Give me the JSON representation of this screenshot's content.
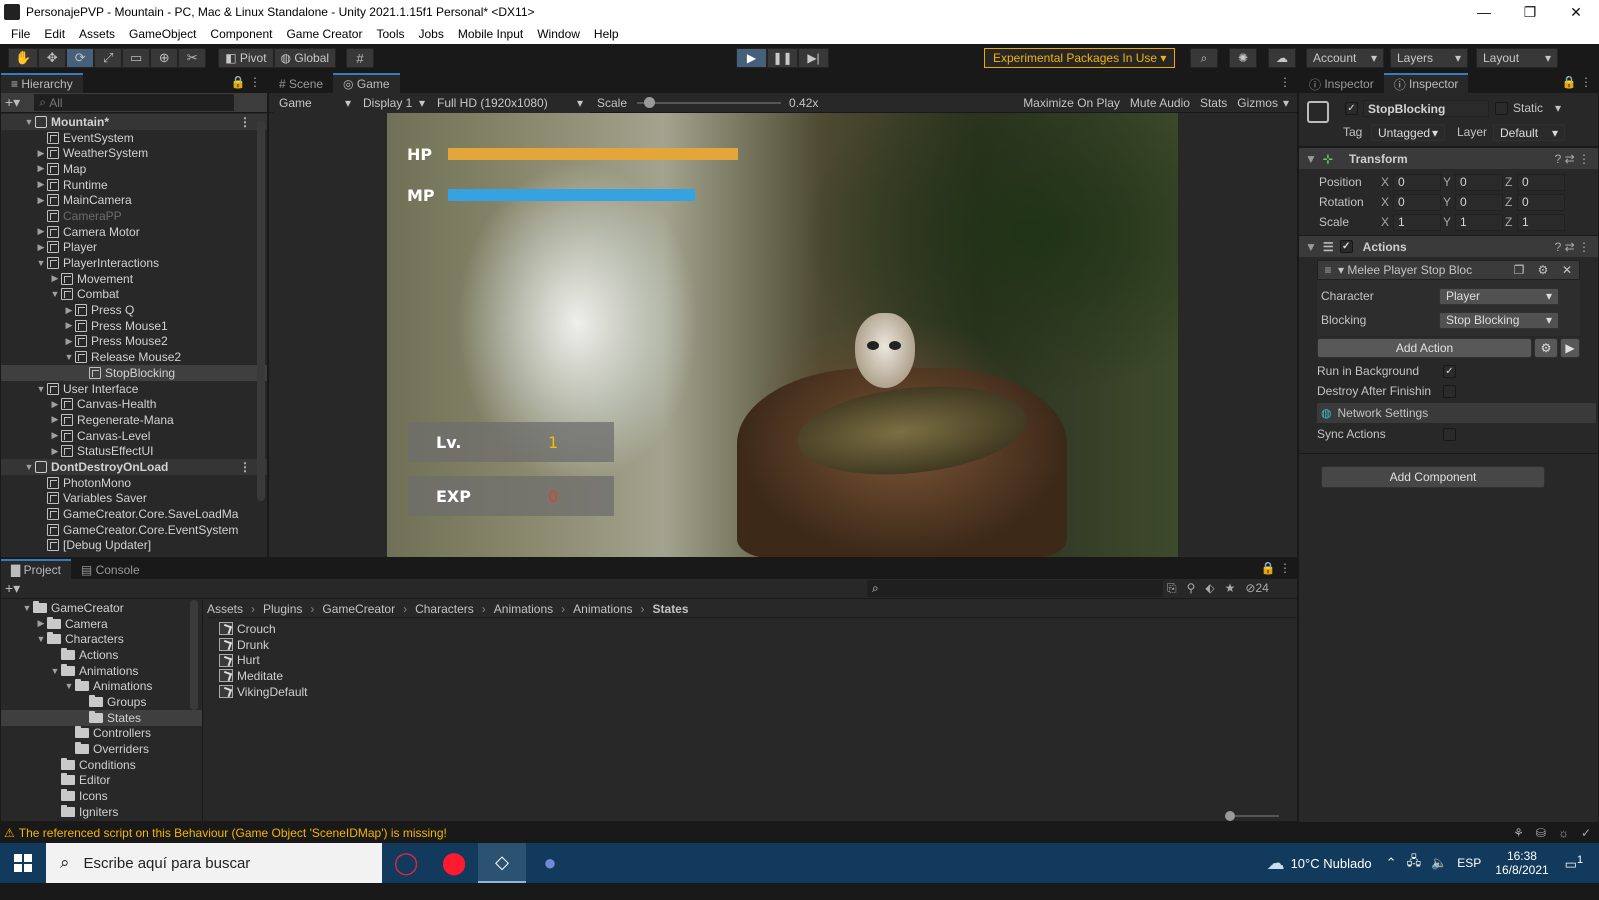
{
  "window": {
    "title": "PersonajePVP - Mountain - PC, Mac & Linux Standalone - Unity 2021.1.15f1 Personal* <DX11>",
    "controls": [
      "—",
      "❐",
      "✕"
    ]
  },
  "menu": [
    "File",
    "Edit",
    "Assets",
    "GameObject",
    "Component",
    "Game Creator",
    "Tools",
    "Jobs",
    "Mobile Input",
    "Window",
    "Help"
  ],
  "toolbar": {
    "pivot_label": "Pivot",
    "global_label": "Global",
    "experimental_label": "Experimental Packages In Use ▾",
    "account_label": "Account",
    "layers_label": "Layers",
    "layout_label": "Layout"
  },
  "hierarchy": {
    "tab": "Hierarchy",
    "search_placeholder": "All",
    "rows": [
      {
        "label": "Mountain*",
        "depth": 0,
        "type": "scene",
        "arrow": "▼"
      },
      {
        "label": "EventSystem",
        "depth": 1,
        "arrow": ""
      },
      {
        "label": "WeatherSystem",
        "depth": 1,
        "arrow": "▶"
      },
      {
        "label": "Map",
        "depth": 1,
        "arrow": "▶"
      },
      {
        "label": "Runtime",
        "depth": 1,
        "arrow": "▶"
      },
      {
        "label": "MainCamera",
        "depth": 1,
        "arrow": "▶"
      },
      {
        "label": "CameraPP",
        "depth": 1,
        "arrow": "",
        "dim": true
      },
      {
        "label": "Camera Motor",
        "depth": 1,
        "arrow": "▶"
      },
      {
        "label": "Player",
        "depth": 1,
        "arrow": "▶"
      },
      {
        "label": "PlayerInteractions",
        "depth": 1,
        "arrow": "▼"
      },
      {
        "label": "Movement",
        "depth": 2,
        "arrow": "▶"
      },
      {
        "label": "Combat",
        "depth": 2,
        "arrow": "▼"
      },
      {
        "label": "Press Q",
        "depth": 3,
        "arrow": "▶"
      },
      {
        "label": "Press Mouse1",
        "depth": 3,
        "arrow": "▶"
      },
      {
        "label": "Press Mouse2",
        "depth": 3,
        "arrow": "▶"
      },
      {
        "label": "Release Mouse2",
        "depth": 3,
        "arrow": "▼"
      },
      {
        "label": "StopBlocking",
        "depth": 4,
        "arrow": "",
        "selected": true
      },
      {
        "label": "User Interface",
        "depth": 1,
        "arrow": "▼"
      },
      {
        "label": "Canvas-Health",
        "depth": 2,
        "arrow": "▶"
      },
      {
        "label": "Regenerate-Mana",
        "depth": 2,
        "arrow": "▶"
      },
      {
        "label": "Canvas-Level",
        "depth": 2,
        "arrow": "▶"
      },
      {
        "label": "StatusEffectUI",
        "depth": 2,
        "arrow": "▶"
      },
      {
        "label": "DontDestroyOnLoad",
        "depth": 0,
        "type": "scene",
        "arrow": "▼"
      },
      {
        "label": "PhotonMono",
        "depth": 1,
        "arrow": ""
      },
      {
        "label": "Variables Saver",
        "depth": 1,
        "arrow": ""
      },
      {
        "label": "GameCreator.Core.SaveLoadMa",
        "depth": 1,
        "arrow": ""
      },
      {
        "label": "GameCreator.Core.EventSystem",
        "depth": 1,
        "arrow": ""
      },
      {
        "label": "[Debug Updater]",
        "depth": 1,
        "arrow": ""
      }
    ]
  },
  "game": {
    "tabs": [
      "Scene",
      "Game"
    ],
    "display_mode": "Game",
    "display": "Display 1",
    "resolution": "Full HD (1920x1080)",
    "scale_label": "Scale",
    "scale_value": "0.42x",
    "scale_fraction": 0.05,
    "toggles": [
      "Maximize On Play",
      "Mute Audio",
      "Stats",
      "Gizmos"
    ],
    "hud": {
      "hp_label": "HP",
      "mp_label": "MP",
      "hp_fill": 1.0,
      "mp_fill": 0.85,
      "hp_color": "#e2a63a",
      "mp_color": "#36a2e0",
      "level_label": "Lv.",
      "level_value": "1",
      "level_color": "#f0c000",
      "exp_label": "EXP",
      "exp_value": "0",
      "exp_color": "#d9433b"
    }
  },
  "inspector": {
    "tabs": [
      "Inspector",
      "Inspector"
    ],
    "object_name": "StopBlocking",
    "static_label": "Static",
    "tag_label": "Tag",
    "tag_value": "Untagged",
    "layer_label": "Layer",
    "layer_value": "Default",
    "transform": {
      "title": "Transform",
      "rows": [
        {
          "label": "Position",
          "x": "0",
          "y": "0",
          "z": "0"
        },
        {
          "label": "Rotation",
          "x": "0",
          "y": "0",
          "z": "0"
        },
        {
          "label": "Scale",
          "x": "1",
          "y": "1",
          "z": "1"
        }
      ]
    },
    "actions": {
      "title": "Actions",
      "item_label": "▾ Melee Player Stop Bloc",
      "character_label": "Character",
      "character_value": "Player",
      "blocking_label": "Blocking",
      "blocking_value": "Stop Blocking",
      "add_action": "Add Action",
      "run_bg_label": "Run in Background",
      "run_bg_checked": "✓",
      "destroy_label": "Destroy After Finishin",
      "network_label": "Network Settings",
      "sync_label": "Sync Actions"
    },
    "add_component": "Add Component"
  },
  "project": {
    "tabs": [
      "Project",
      "Console"
    ],
    "hidden_count": "24",
    "tree": [
      {
        "label": "GameCreator",
        "depth": 1,
        "arrow": "▼",
        "open": true
      },
      {
        "label": "Camera",
        "depth": 2,
        "arrow": "▶"
      },
      {
        "label": "Characters",
        "depth": 2,
        "arrow": "▼",
        "open": true
      },
      {
        "label": "Actions",
        "depth": 3,
        "arrow": ""
      },
      {
        "label": "Animations",
        "depth": 3,
        "arrow": "▼",
        "open": true
      },
      {
        "label": "Animations",
        "depth": 4,
        "arrow": "▼",
        "open": true
      },
      {
        "label": "Groups",
        "depth": 5,
        "arrow": ""
      },
      {
        "label": "States",
        "depth": 5,
        "arrow": "",
        "selected": true
      },
      {
        "label": "Controllers",
        "depth": 4,
        "arrow": ""
      },
      {
        "label": "Overriders",
        "depth": 4,
        "arrow": ""
      },
      {
        "label": "Conditions",
        "depth": 3,
        "arrow": ""
      },
      {
        "label": "Editor",
        "depth": 3,
        "arrow": ""
      },
      {
        "label": "Icons",
        "depth": 3,
        "arrow": ""
      },
      {
        "label": "Igniters",
        "depth": 3,
        "arrow": ""
      }
    ],
    "breadcrumb": [
      "Assets",
      "Plugins",
      "GameCreator",
      "Characters",
      "Animations",
      "Animations",
      "States"
    ],
    "files": [
      "Crouch",
      "Drunk",
      "Hurt",
      "Meditate",
      "VikingDefault"
    ]
  },
  "status": {
    "message": "The referenced script on this Behaviour (Game Object 'SceneIDMap') is missing!"
  },
  "taskbar": {
    "search_placeholder": "Escribe aquí para buscar",
    "weather": "10°C  Nublado",
    "lang": "ESP",
    "time": "16:38",
    "date": "16/8/2021",
    "notif_count": "1"
  },
  "colors": {
    "accent": "#3a79bb",
    "warning": "#f5b400",
    "play_active": "#46607c"
  }
}
